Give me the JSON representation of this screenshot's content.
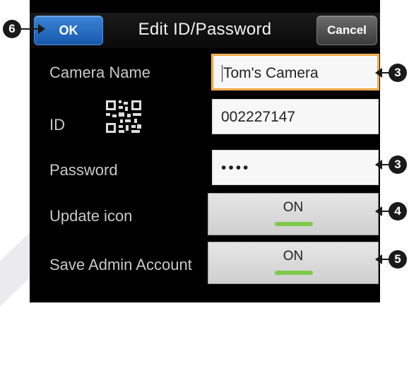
{
  "header": {
    "title": "Edit ID/Password",
    "ok_label": "OK",
    "cancel_label": "Cancel"
  },
  "form": {
    "camera_name": {
      "label": "Camera Name",
      "value": "Tom's Camera"
    },
    "id": {
      "label": "ID",
      "value": "002227147"
    },
    "password": {
      "label": "Password",
      "value": "••••"
    },
    "update_icon": {
      "label": "Update icon",
      "value": "ON"
    },
    "save_admin": {
      "label": "Save Admin Account",
      "value": "ON"
    }
  },
  "callouts": {
    "ok": "6",
    "camera_name": "3",
    "password": "3",
    "update_icon": "4",
    "save_admin": "5"
  },
  "colors": {
    "ok_button": "#1f6fc6",
    "focus_border": "#f0a33a",
    "toggle_indicator": "#7ec94a"
  }
}
